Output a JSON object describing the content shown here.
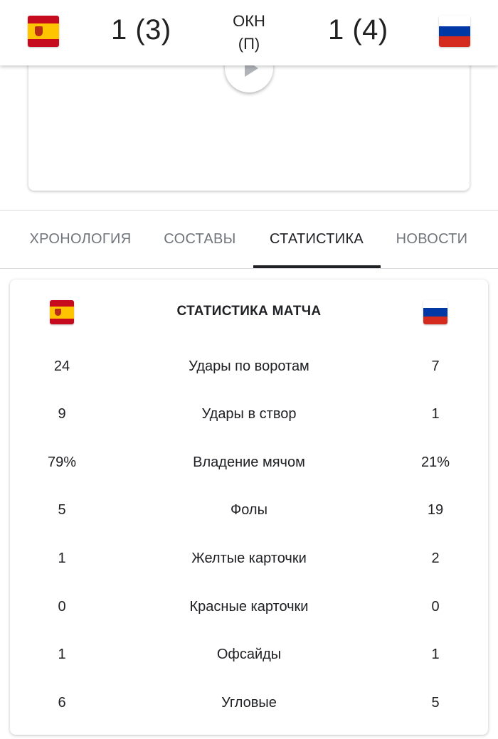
{
  "match": {
    "home_team": {
      "flag_icon": "spain-flag-icon",
      "score": "1 (3)"
    },
    "away_team": {
      "flag_icon": "russia-flag-icon",
      "score": "1 (4)"
    },
    "status_line1": "ОКН",
    "status_line2": "(П)"
  },
  "video": {
    "play_icon": "play-icon"
  },
  "tabs": [
    {
      "label": "ХРОНОЛОГИЯ",
      "active": false
    },
    {
      "label": "СОСТАВЫ",
      "active": false
    },
    {
      "label": "СТАТИСТИКА",
      "active": true
    },
    {
      "label": "НОВОСТИ",
      "active": false
    }
  ],
  "stats": {
    "title": "СТАТИСТИКА МАТЧА",
    "rows": [
      {
        "label": "Удары по воротам",
        "home": "24",
        "away": "7"
      },
      {
        "label": "Удары в створ",
        "home": "9",
        "away": "1"
      },
      {
        "label": "Владение мячом",
        "home": "79%",
        "away": "21%"
      },
      {
        "label": "Фолы",
        "home": "5",
        "away": "19"
      },
      {
        "label": "Желтые карточки",
        "home": "1",
        "away": "2"
      },
      {
        "label": "Красные карточки",
        "home": "0",
        "away": "0"
      },
      {
        "label": "Офсайды",
        "home": "1",
        "away": "1"
      },
      {
        "label": "Угловые",
        "home": "6",
        "away": "5"
      }
    ]
  },
  "colors": {
    "spain_red": "#c60b1e",
    "spain_yellow": "#ffc400",
    "russia_white": "#ffffff",
    "russia_blue": "#0039a6",
    "russia_red": "#d52b1e",
    "active_tab": "#202124",
    "inactive_tab": "#70757a"
  }
}
